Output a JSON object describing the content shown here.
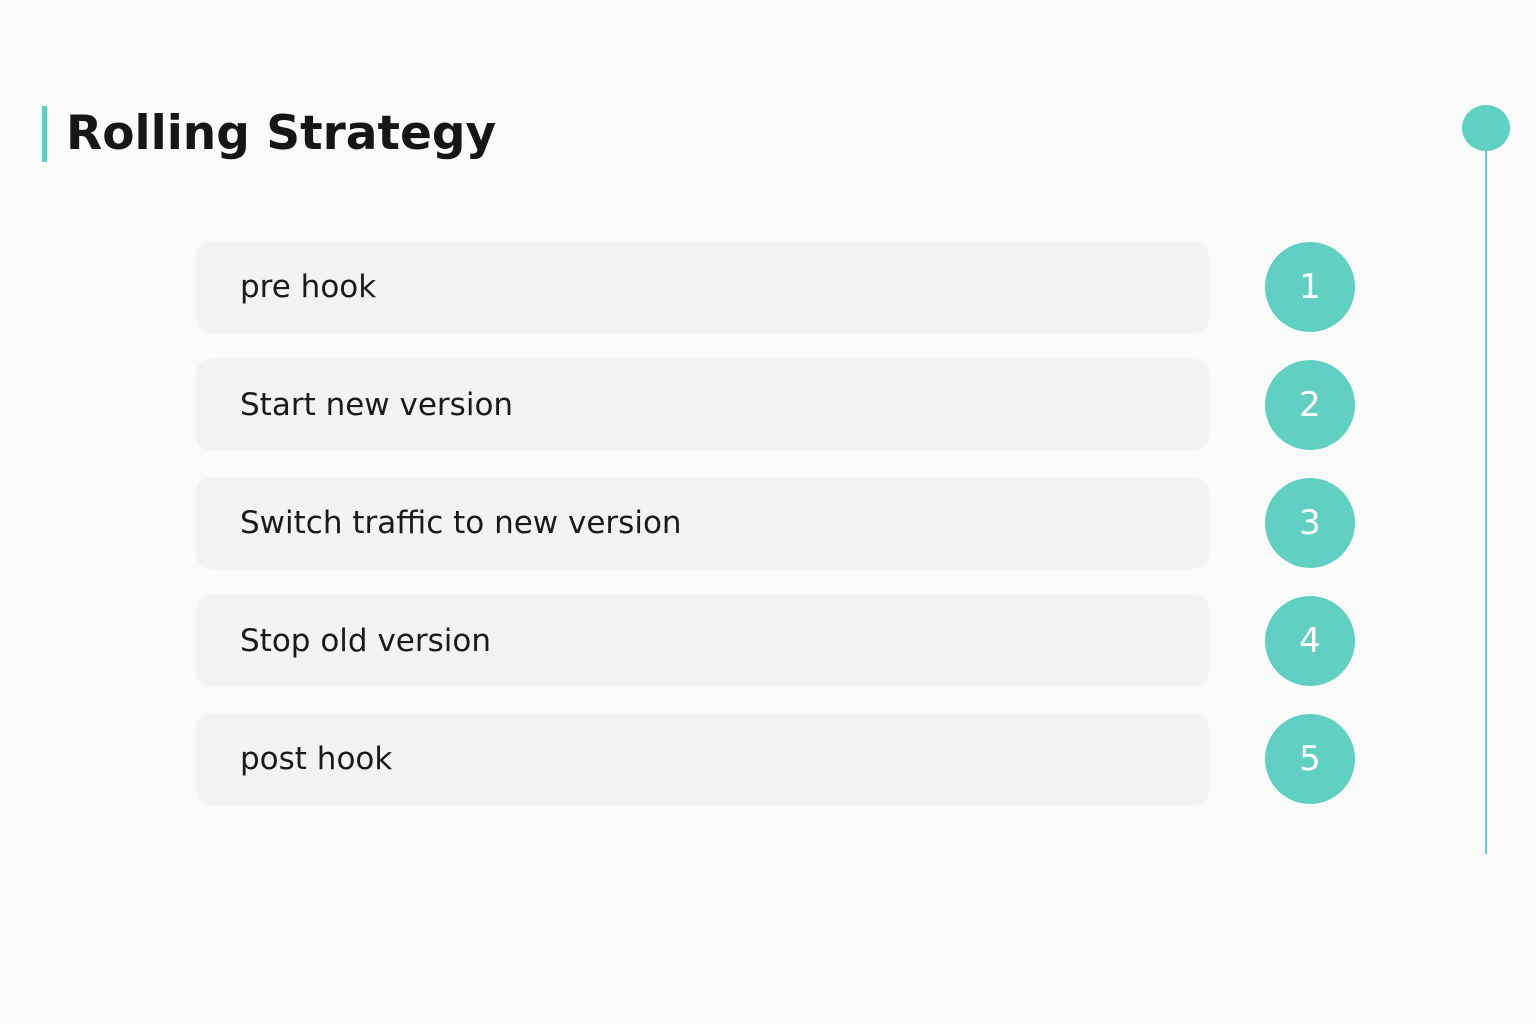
{
  "title": "Rolling Strategy",
  "accent_color": "#62cfc3",
  "steps": [
    {
      "number": "1",
      "label": "pre hook"
    },
    {
      "number": "2",
      "label": "Start new version"
    },
    {
      "number": "3",
      "label": "Switch traffic to new version"
    },
    {
      "number": "4",
      "label": "Stop old version"
    },
    {
      "number": "5",
      "label": "post hook"
    }
  ]
}
